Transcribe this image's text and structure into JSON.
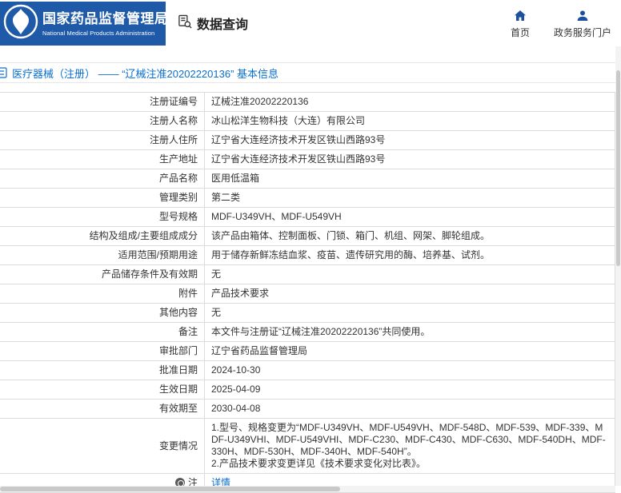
{
  "header": {
    "org_name_cn": "国家药品监督管理局",
    "org_name_en": "National Medical Products Administration",
    "section_title": "数据查询",
    "nav": [
      {
        "label": "首页",
        "icon": "home-icon"
      },
      {
        "label": "政务服务门户",
        "icon": "user-icon"
      }
    ]
  },
  "breadcrumb": {
    "text": "医疗器械（注册） —— “辽械注准20202220136” 基本信息"
  },
  "table": {
    "rows": [
      {
        "label": "注册证编号",
        "value": "辽械注准20202220136"
      },
      {
        "label": "注册人名称",
        "value": "冰山松洋生物科技（大连）有限公司"
      },
      {
        "label": "注册人住所",
        "value": "辽宁省大连经济技术开发区铁山西路93号"
      },
      {
        "label": "生产地址",
        "value": "辽宁省大连经济技术开发区铁山西路93号"
      },
      {
        "label": "产品名称",
        "value": "医用低温箱"
      },
      {
        "label": "管理类别",
        "value": "第二类"
      },
      {
        "label": "型号规格",
        "value": "MDF-U349VH、MDF-U549VH"
      },
      {
        "label": "结构及组成/主要组成成分",
        "value": "该产品由箱体、控制面板、门锁、箱门、机组、网架、脚轮组成。"
      },
      {
        "label": "适用范围/预期用途",
        "value": "用于储存新鲜冻结血浆、疫苗、遗传研究用的酶、培养基、试剂。"
      },
      {
        "label": "产品储存条件及有效期",
        "value": "无"
      },
      {
        "label": "附件",
        "value": "产品技术要求"
      },
      {
        "label": "其他内容",
        "value": "无"
      },
      {
        "label": "备注",
        "value": "本文件与注册证“辽械注准20202220136”共同使用。"
      },
      {
        "label": "审批部门",
        "value": "辽宁省药品监督管理局"
      },
      {
        "label": "批准日期",
        "value": "2024-10-30"
      },
      {
        "label": "生效日期",
        "value": "2025-04-09"
      },
      {
        "label": "有效期至",
        "value": "2030-04-08"
      },
      {
        "label": "变更情况",
        "value": [
          "1.型号、规格变更为“MDF-U349VH、MDF-U549VH、MDF-548D、MDF-539、MDF-339、MDF-U349VHI、MDF-U549VHI、MDF-C230、MDF-C430、MDF-C630、MDF-540DH、MDF-330H、MDF-530H、MDF-340H、MDF-540H”。",
          "2.产品技术要求变更详见《技术要求变化对比表》。"
        ]
      },
      {
        "label": "注",
        "label_icon": "note-icon",
        "value": "详情",
        "link": true
      }
    ]
  },
  "colors": {
    "header_blue": "#1e5aa8",
    "link_blue": "#0a6fce",
    "nav_icon_blue": "#1d4f9f",
    "border_gray": "#dcdcdc",
    "text": "#333333"
  }
}
